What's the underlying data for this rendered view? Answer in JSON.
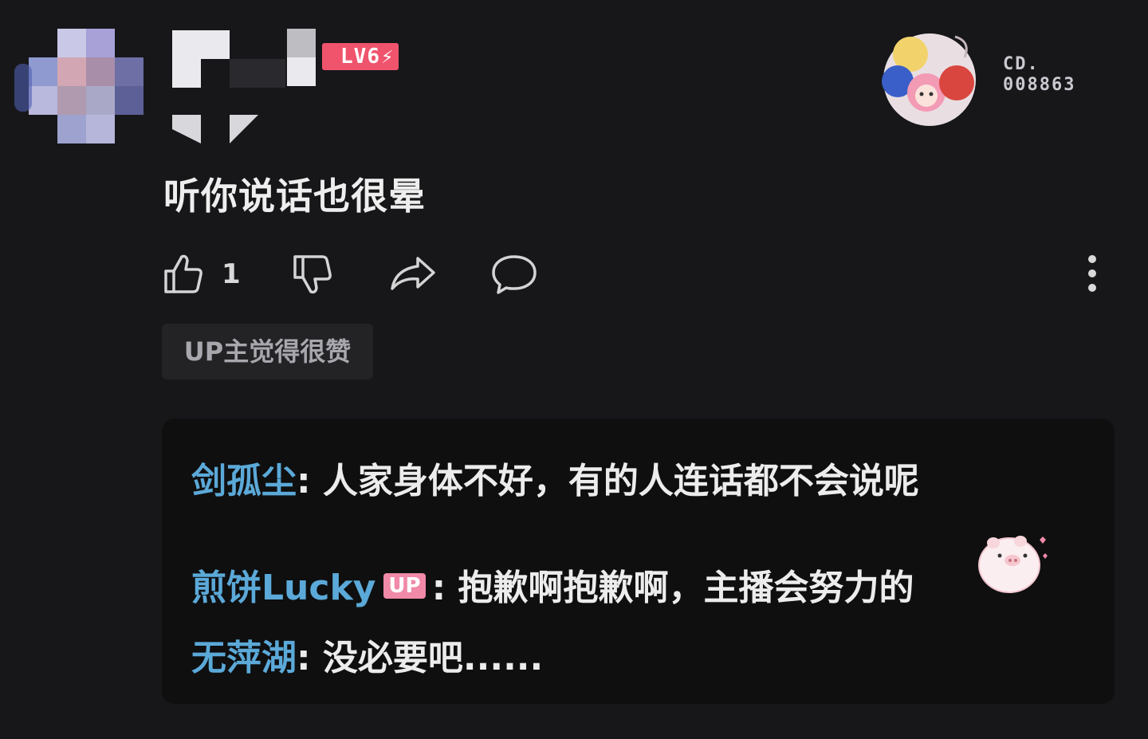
{
  "user": {
    "level_badge": "LV6",
    "fan_number_label": "CD.",
    "fan_number": "008863"
  },
  "comment": {
    "text": "听你说话也很晕"
  },
  "actions": {
    "like_count": "1"
  },
  "up_liked_tag": "UP主觉得很赞",
  "replies": [
    {
      "name": "剑孤尘",
      "separator": ":",
      "text": " 人家身体不好，有的人连话都不会说呢"
    },
    {
      "name": "煎饼Lucky",
      "badge": "UP",
      "separator": ":",
      "text": " 抱歉啊抱歉啊，主播会努力的"
    },
    {
      "name": "无萍湖",
      "separator": ":",
      "text": " 没必要吧......"
    }
  ],
  "colors": {
    "background": "#17171a",
    "reply_box": "#0f0f10",
    "name_blue": "#5ba9d8",
    "level_pink": "#f0546d",
    "up_badge_pink": "#f08aa8"
  }
}
